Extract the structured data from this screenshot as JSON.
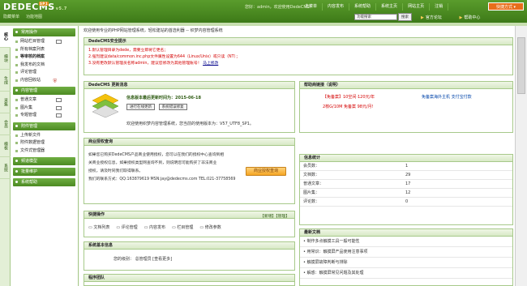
{
  "brand": {
    "logo": "DEDECMS",
    "version": "v5.7",
    "badge": "SP1"
  },
  "toplinks": [
    "隐藏菜单",
    "功能地图"
  ],
  "welcome": "您好：admin，欢迎使用DedeCMS！",
  "nav": [
    "主菜单",
    "内容发布",
    "系统设置",
    "会员",
    "模板",
    "生成",
    "采集",
    "系统"
  ],
  "mainnav": [
    "主菜单",
    "内容发布",
    "系统帮助",
    "系统主页",
    "网站主页",
    "注销"
  ],
  "quick": "快捷方式 ▾",
  "search": {
    "placeholder": "功能搜索",
    "button": "搜索"
  },
  "rightlinks": [
    "官方论坛",
    "帮助中心"
  ],
  "sidetabs": [
    "核心",
    "模块",
    "生成",
    "采集",
    "会员",
    "模板",
    "系统"
  ],
  "menu": {
    "g1": "常用操作",
    "g1items": [
      "网站栏目管理",
      "所有档案列表",
      "等审核的档案",
      "我发布的文档",
      "评论管理",
      "内容回收站"
    ],
    "g2": "内容管理",
    "g2items": [
      "普通文章",
      "图片集",
      "专题管理"
    ],
    "g3": "附件管理",
    "g3items": [
      "上传新文件",
      "附件数据管理",
      "文件式管理器"
    ],
    "g4": "频道模型",
    "g5": "批量维护",
    "g6": "系统帮助"
  },
  "breadcrumb": "欢迎使用专业的PHP网站管理系统，轻松建站的首选利器 -- 织梦内容管理系统",
  "security": {
    "title": "DedeCMS安全提示",
    "lines": [
      "1.默认管理目录为dede，需要立即将它更名；",
      "2.强烈建议data/common.inc.php文件属性设置为644（Linux/Unix）或只读（NT）；",
      "3.没有更改默认管理员名称admin，建议您修改为其他管理账号！"
    ],
    "link": "马上修改"
  },
  "update": {
    "title": "DedeCMS 更新消息",
    "info": "信息版本最后更新时间为：2015-06-18",
    "btn1": "进行在线更新",
    "btn2": "系统错误修复",
    "desc": "欢迎使用织梦内容管理系统，您当前的使用版本为：V57_UTF8_SP1。"
  },
  "biz": {
    "title": "商业授权查询",
    "text": [
      "如果您已购买DedeCMS产品商业使用授权，您可以在我们的授权中心查询到相",
      "关商业授权信息，如果授权类型网查询不到，则说明您可能购买了非法商业",
      "授权，请及时同我们取得联系。"
    ],
    "contact": "我们的联系方式：QQ:163879619 MSN:jay@dedecms.com TEL:021-37758569",
    "btn": "商业授权查询"
  },
  "help": {
    "title": "帮助商链接（说明）",
    "l1": "【免备案】10空间·120元/年",
    "l2": "免备案海外主机 支付宝付款",
    "l3": "2核G/10M 免备案 98元/月!"
  },
  "quickops": {
    "title": "快捷操作",
    "links": "【新增】【管理】",
    "items": [
      "文档列表",
      "评论管理",
      "内容发布",
      "栏目管理",
      "修改参数"
    ]
  },
  "sysinfo": {
    "title": "系统基本信息",
    "text": "您的级别： 总管理员 [查看更多]"
  },
  "team": {
    "title": "程序团队"
  },
  "stats": {
    "title": "信息统计",
    "rows": [
      [
        "会员数：",
        "1"
      ],
      [
        "文档数：",
        "29"
      ],
      [
        "普通文章：",
        "17"
      ],
      [
        "图片集：",
        "12"
      ],
      [
        "评论数：",
        "0"
      ]
    ]
  },
  "latest": {
    "title": "最新文档",
    "items": [
      "• 制作多点触摸工具一般可能性",
      "• 用常识：触摸屏产品使用注意事项",
      "• 触摸屏故障判断与排除",
      "• 解惑：触摸屏常见问题及其处理"
    ]
  }
}
